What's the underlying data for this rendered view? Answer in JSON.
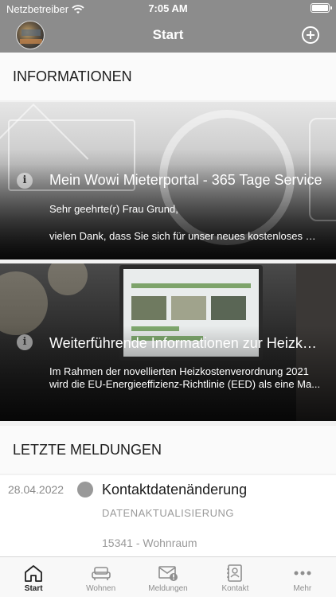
{
  "status_bar": {
    "carrier": "Netzbetreiber",
    "time": "7:05 AM"
  },
  "nav": {
    "title": "Start",
    "avatar_icon": "avatar",
    "add_icon": "plus-circle-icon"
  },
  "sections": {
    "info": "INFORMATIONEN",
    "news": "LETZTE MELDUNGEN"
  },
  "cards": [
    {
      "title": "Mein Wowi Mieterportal - 365 Tage Service",
      "line1": "Sehr geehrte(r) Frau Grund,",
      "line2": "vielen Dank, dass Sie sich für unser neues kostenloses Mieterportal entschieden haben."
    },
    {
      "title": "Weiterführende Informationen zur Heizkostenverordnung",
      "text": "Im Rahmen der novellierten Heizkostenverordnung 2021 wird die EU-Energieeffizienz-Richtlinie (EED) als eine Ma..."
    }
  ],
  "news": [
    {
      "date": "28.04.2022",
      "title": "Kontaktdatenänderung",
      "category": "DATENAKTUALISIERUNG",
      "unit": "15341 - Wohnraum"
    }
  ],
  "tabs": [
    {
      "label": "Start",
      "icon": "home-icon",
      "active": true
    },
    {
      "label": "Wohnen",
      "icon": "sofa-icon",
      "active": false
    },
    {
      "label": "Meldungen",
      "icon": "mail-alert-icon",
      "active": false
    },
    {
      "label": "Kontakt",
      "icon": "contact-book-icon",
      "active": false
    },
    {
      "label": "Mehr",
      "icon": "more-icon",
      "active": false
    }
  ],
  "colors": {
    "header": "#8c8c8c",
    "tab_active": "#222222",
    "tab_inactive": "#8e8e8e"
  }
}
